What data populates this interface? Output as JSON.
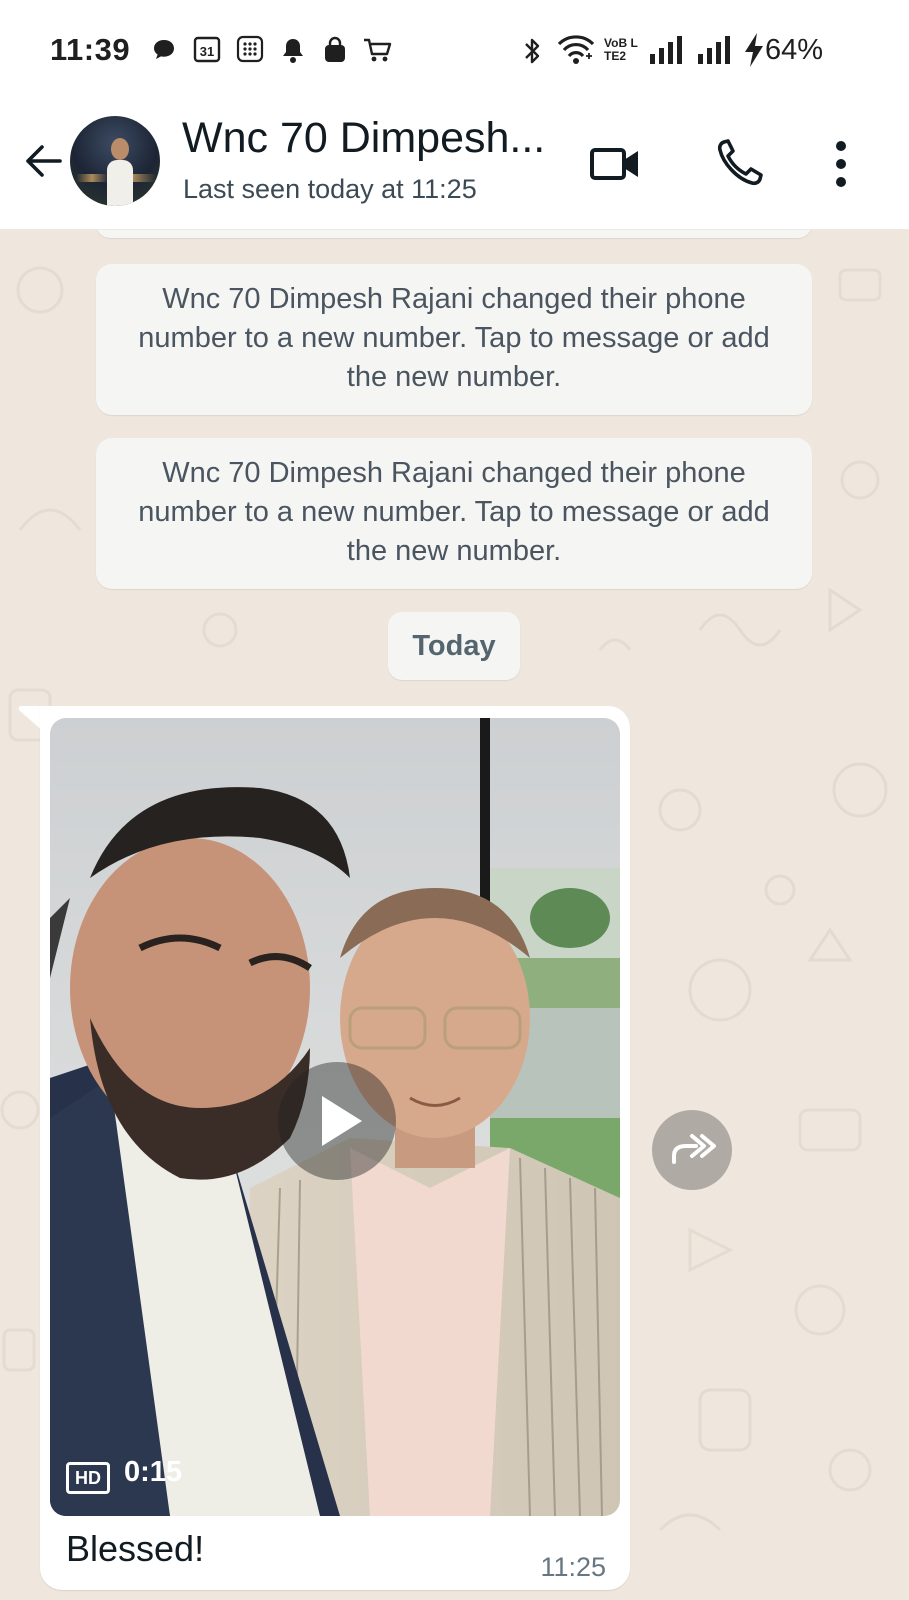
{
  "status_bar": {
    "time": "11:39",
    "network_label": "VoB LTE2",
    "battery": "64%",
    "left_icons": [
      "chat-bubble-icon",
      "calendar-icon",
      "keypad-icon",
      "bell-icon",
      "shopping-bag-icon",
      "cart-icon"
    ],
    "right_icons": [
      "bluetooth-icon",
      "wifi-icon",
      "signal-icon",
      "signal-icon",
      "charging-icon"
    ]
  },
  "header": {
    "contact_name": "Wnc 70 Dimpesh...",
    "last_seen": "Last seen today at 11:25",
    "icons": [
      "back-arrow-icon",
      "video-call-icon",
      "phone-call-icon",
      "more-options-icon"
    ]
  },
  "messages": {
    "system_1": "Wnc 70 Dimpesh Rajani changed their phone number to a new number. Tap to message or add the new number.",
    "system_2": "Wnc 70 Dimpesh Rajani changed their phone number to a new number. Tap to message or add the new number.",
    "date_separator": "Today",
    "video_message": {
      "hd_label": "HD",
      "duration": "0:15",
      "caption": "Blessed!",
      "time": "11:25"
    }
  },
  "colors": {
    "chat_background": "#efe7de",
    "bubble": "#ffffff",
    "system_bubble": "#f5f5f4",
    "timestamp": "#667781"
  }
}
